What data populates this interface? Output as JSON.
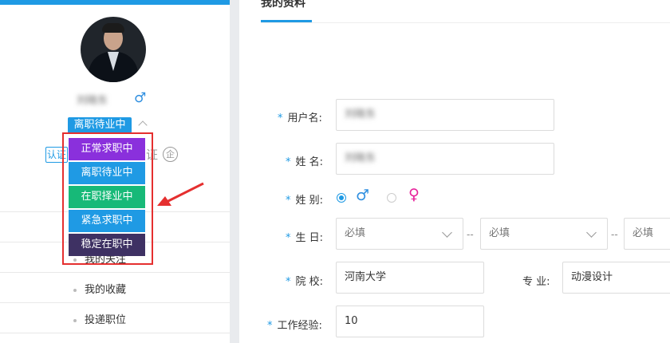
{
  "profile": {
    "username": "刘晓东",
    "status": "离职待业中",
    "cert_label": "认证",
    "cert_label_2": "证",
    "cert_circle": "企"
  },
  "status_dropdown": {
    "options": [
      {
        "label": "正常求职中",
        "color": "#8a30dc"
      },
      {
        "label": "离职待业中",
        "color": "#1f9ae4"
      },
      {
        "label": "在职择业中",
        "color": "#17b978"
      },
      {
        "label": "紧急求职中",
        "color": "#1f9ae4"
      },
      {
        "label": "稳定在职中",
        "color": "#3e3163"
      }
    ]
  },
  "sidebar": {
    "items": [
      {
        "label": "我的关注"
      },
      {
        "label": "我的收藏"
      },
      {
        "label": "投递职位"
      }
    ]
  },
  "main": {
    "title": "我的资料"
  },
  "form": {
    "username": {
      "label": "用户名:",
      "value": "刘晓东"
    },
    "name": {
      "label": "姓 名:",
      "value": "刘晓东"
    },
    "gender": {
      "label": "姓 别:",
      "male": "♂",
      "female": "♀"
    },
    "birthday": {
      "label": "生 日:",
      "year": "必填",
      "month": "必填",
      "day": "必填",
      "separator": "--"
    },
    "school": {
      "label": "院 校:",
      "value": "河南大学"
    },
    "major": {
      "label": "专 业:",
      "value": "动漫设计"
    },
    "experience": {
      "label": "工作经验:",
      "value": "10"
    }
  },
  "colors": {
    "accent": "#1f9ae4",
    "highlight_border": "#e52f2f",
    "male": "#2f8fe0",
    "female": "#e7229b"
  }
}
